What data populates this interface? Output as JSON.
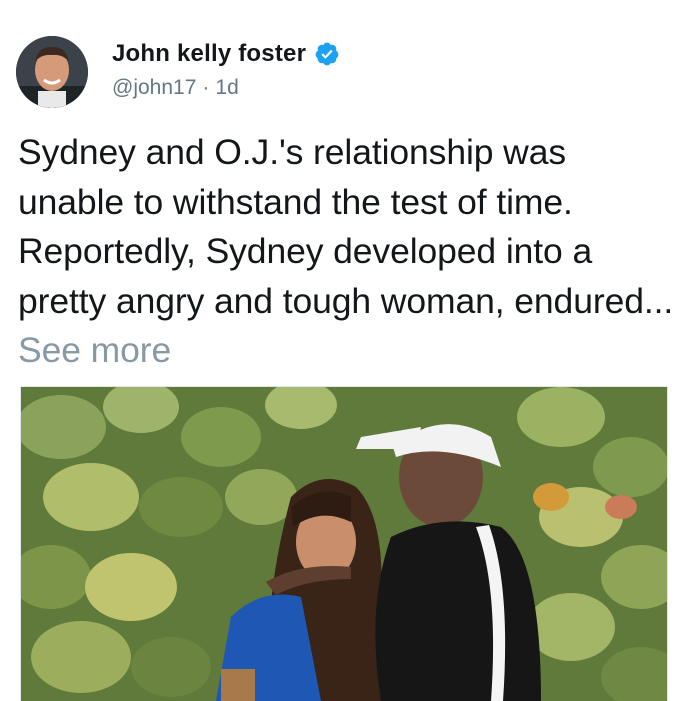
{
  "tweet": {
    "author_name": "John kelly foster",
    "handle": "@john17",
    "separator": "·",
    "timestamp": "1d",
    "verified": true,
    "text_main": "Sydney and O.J.'s relationship was unable to withstand the test of time. Reportedly, Sydney developed into a pretty angry and tough woman, endured...",
    "see_more_label": "See more"
  },
  "icons": {
    "verified": "verified-badge-icon",
    "avatar": "avatar"
  },
  "colors": {
    "text": "#14171a",
    "secondary": "#657786",
    "see_more": "#8899a6",
    "verified": "#1da1f2"
  }
}
